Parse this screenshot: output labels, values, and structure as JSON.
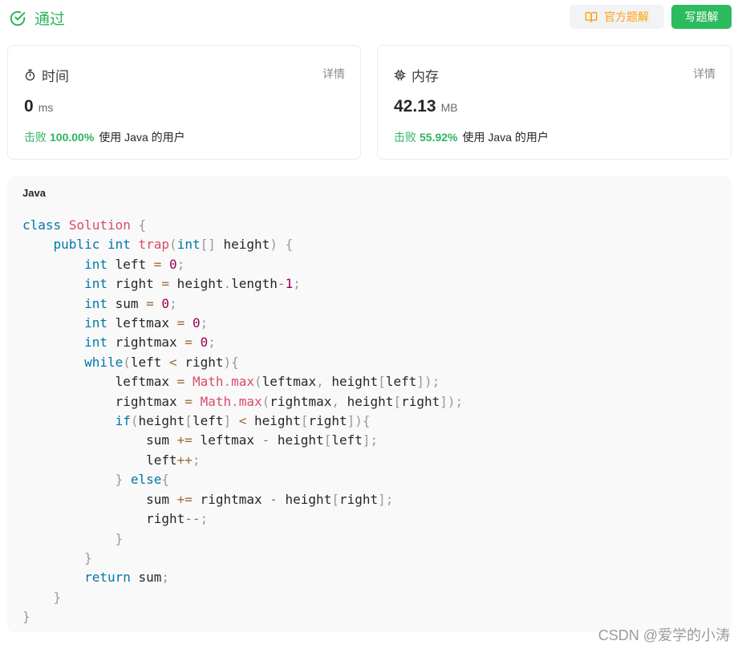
{
  "header": {
    "status_label": "通过",
    "official_solution_label": "官方题解",
    "write_solution_label": "写题解"
  },
  "runtime": {
    "title": "时间",
    "detail_label": "详情",
    "value": "0",
    "unit": "ms",
    "beat_prefix": "击败",
    "beat_percent": "100.00%",
    "beat_suffix": "使用 Java 的用户"
  },
  "memory": {
    "title": "内存",
    "detail_label": "详情",
    "value": "42.13",
    "unit": "MB",
    "beat_prefix": "击败",
    "beat_percent": "55.92%",
    "beat_suffix": "使用 Java 的用户"
  },
  "code": {
    "language": "Java",
    "lines": [
      "class Solution {",
      "    public int trap(int[] height) {",
      "        int left = 0;",
      "        int right = height.length-1;",
      "        int sum = 0;",
      "        int leftmax = 0;",
      "        int rightmax = 0;",
      "        while(left < right){",
      "            leftmax = Math.max(leftmax, height[left]);",
      "            rightmax = Math.max(rightmax, height[right]);",
      "            if(height[left] < height[right]){",
      "                sum += leftmax - height[left];",
      "                left++;",
      "            } else{",
      "                sum += rightmax - height[right];",
      "                right--;",
      "            }",
      "        }",
      "        return sum;",
      "    }",
      "}"
    ]
  },
  "watermark": "CSDN @爱学的小涛",
  "colors": {
    "success_green": "#2db55d",
    "button_green": "#2cbb5d",
    "official_orange": "#ffa116"
  },
  "icons": {
    "status": "check-circle-icon",
    "official": "book-icon",
    "runtime": "stopwatch-icon",
    "memory": "chip-icon"
  }
}
